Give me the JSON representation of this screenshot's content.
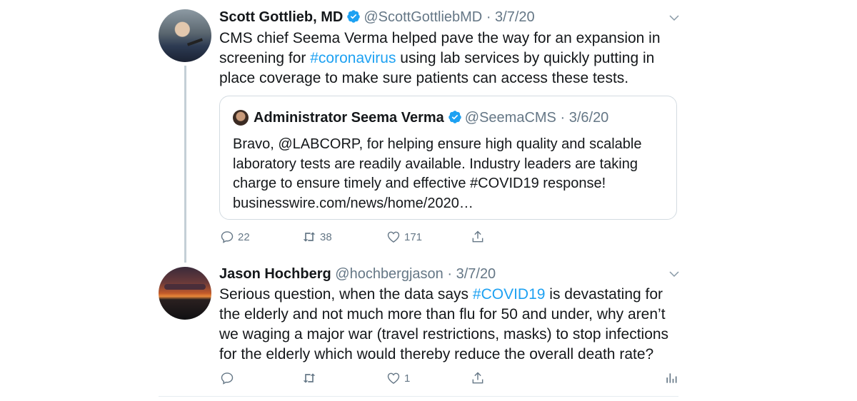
{
  "tweets": [
    {
      "name": "Scott Gottlieb, MD",
      "handle": "@ScottGottliebMD",
      "separator": "·",
      "date": "3/7/20",
      "text_before": "CMS chief Seema Verma helped pave the way for an expansion in screening for ",
      "hashtag": "#coronavirus",
      "text_after": " using lab services by quickly putting in place coverage to make sure patients can access these tests.",
      "quote": {
        "name": "Administrator Seema Verma",
        "handle": "@SeemaCMS",
        "separator": "·",
        "date": "3/6/20",
        "text": "Bravo, @LABCORP, for helping ensure high quality and scalable laboratory tests are readily available. Industry leaders are taking charge to ensure timely and effective #COVID19 response! businesswire.com/news/home/2020…"
      },
      "actions": {
        "replies": "22",
        "retweets": "38",
        "likes": "171"
      }
    },
    {
      "name": "Jason Hochberg",
      "handle": "@hochbergjason",
      "separator": "·",
      "date": "3/7/20",
      "text_before": "Serious question, when the data says ",
      "hashtag": "#COVID19",
      "text_after": " is devastating for the elderly and not much more than flu for 50 and under, why aren’t we waging a major war (travel restrictions, masks) to stop infections for the elderly which would thereby reduce the overall death rate?",
      "actions": {
        "replies": "",
        "retweets": "",
        "likes": "1"
      }
    }
  ],
  "icons": {
    "verified": "verified-badge-icon",
    "more": "chevron-down-icon",
    "reply": "reply-icon",
    "retweet": "retweet-icon",
    "like": "heart-icon",
    "share": "share-icon",
    "analytics": "analytics-icon"
  },
  "colors": {
    "link": "#1da1f2",
    "muted": "#657786",
    "text": "#14171a",
    "thread_line": "#c4cfd6"
  }
}
